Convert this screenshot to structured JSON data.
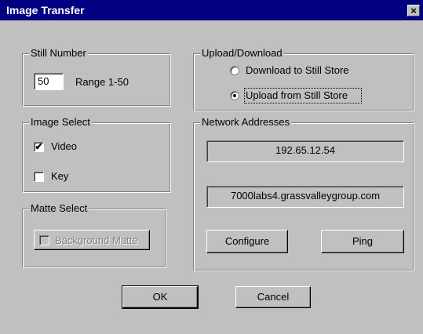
{
  "window": {
    "title": "Image Transfer",
    "close_glyph": "×"
  },
  "still_number": {
    "legend": "Still Number",
    "value": "50",
    "range_label": "Range 1-50"
  },
  "image_select": {
    "legend": "Image Select",
    "video_label": "Video",
    "video_checked": true,
    "key_label": "Key",
    "key_checked": false
  },
  "matte_select": {
    "legend": "Matte Select",
    "background_matte_label": "Background Matte",
    "enabled": false
  },
  "upload_download": {
    "legend": "Upload/Download",
    "download_label": "Download to Still Store",
    "upload_label": "Upload from Still Store",
    "selected": "upload"
  },
  "network": {
    "legend": "Network Addresses",
    "ip": "192.65.12.54",
    "host": "7000labs4.grassvalleygroup.com",
    "configure_label": "Configure",
    "ping_label": "Ping"
  },
  "buttons": {
    "ok_label": "OK",
    "cancel_label": "Cancel"
  },
  "check_glyph": "✔"
}
